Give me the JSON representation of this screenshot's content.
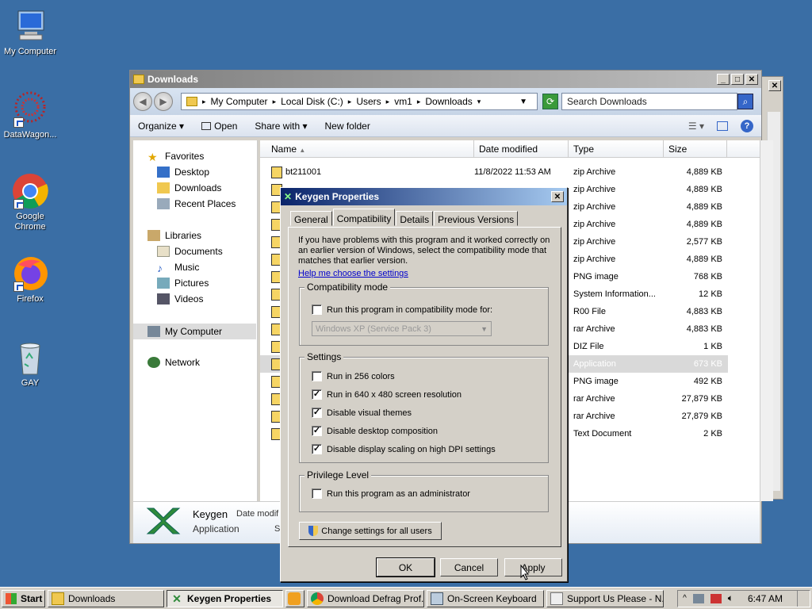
{
  "desktop": {
    "icons": [
      {
        "label": "My Computer",
        "icon": "computer-icon"
      },
      {
        "label": "DataWagon...",
        "icon": "datawagon-icon"
      },
      {
        "label": "Google Chrome",
        "icon": "chrome-icon"
      },
      {
        "label": "Firefox",
        "icon": "firefox-icon"
      },
      {
        "label": "GAY",
        "icon": "recycle-bin-icon"
      }
    ]
  },
  "explorer": {
    "title": "Downloads",
    "breadcrumb": [
      "My Computer",
      "Local Disk (C:)",
      "Users",
      "vm1",
      "Downloads"
    ],
    "search_placeholder": "Search Downloads",
    "commands": {
      "organize": "Organize",
      "open": "Open",
      "share": "Share with",
      "newfolder": "New folder"
    },
    "nav": {
      "favorites": "Favorites",
      "desktop": "Desktop",
      "downloads": "Downloads",
      "recent": "Recent Places",
      "libraries": "Libraries",
      "documents": "Documents",
      "music": "Music",
      "pictures": "Pictures",
      "videos": "Videos",
      "mycomputer": "My Computer",
      "network": "Network"
    },
    "columns": {
      "name": "Name",
      "date": "Date modified",
      "type": "Type",
      "size": "Size"
    },
    "files": [
      {
        "name": "bt211001",
        "date": "11/8/2022 11:53 AM",
        "type": "zip Archive",
        "size": "4,889 KB"
      },
      {
        "name": "",
        "date": "",
        "type": "zip Archive",
        "size": "4,889 KB"
      },
      {
        "name": "",
        "date": "",
        "type": "zip Archive",
        "size": "4,889 KB"
      },
      {
        "name": "",
        "date": "",
        "type": "zip Archive",
        "size": "4,889 KB"
      },
      {
        "name": "",
        "date": "",
        "type": "zip Archive",
        "size": "2,577 KB"
      },
      {
        "name": "",
        "date": "",
        "type": "zip Archive",
        "size": "4,889 KB"
      },
      {
        "name": "",
        "date": "",
        "type": "PNG image",
        "size": "768 KB"
      },
      {
        "name": "",
        "date": "",
        "type": "System Information...",
        "size": "12 KB"
      },
      {
        "name": "",
        "date": "",
        "type": "R00 File",
        "size": "4,883 KB"
      },
      {
        "name": "",
        "date": "",
        "type": "rar Archive",
        "size": "4,883 KB"
      },
      {
        "name": "",
        "date": "",
        "type": "DIZ File",
        "size": "1 KB"
      },
      {
        "name": "",
        "date": "",
        "type": "Application",
        "size": "673 KB"
      },
      {
        "name": "",
        "date": "",
        "type": "PNG image",
        "size": "492 KB"
      },
      {
        "name": "",
        "date": "",
        "type": "rar Archive",
        "size": "27,879 KB"
      },
      {
        "name": "",
        "date": "",
        "type": "rar Archive",
        "size": "27,879 KB"
      },
      {
        "name": "",
        "date": "",
        "type": "Text Document",
        "size": "2 KB"
      }
    ],
    "details": {
      "name": "Keygen",
      "type": "Application",
      "date_label": "Date modif",
      "size_label": "Si"
    }
  },
  "dialog": {
    "title": "Keygen Properties",
    "tabs": [
      "General",
      "Compatibility",
      "Details",
      "Previous Versions"
    ],
    "intro": "If you have problems with this program and it worked correctly on an earlier version of Windows, select the compatibility mode that matches that earlier version.",
    "help_link": "Help me choose the settings",
    "compat_group": "Compatibility mode",
    "compat_check": "Run this program in compatibility mode for:",
    "compat_select": "Windows XP (Service Pack 3)",
    "settings_group": "Settings",
    "settings": [
      {
        "label": "Run in 256 colors",
        "checked": false
      },
      {
        "label": "Run in 640 x 480 screen resolution",
        "checked": true
      },
      {
        "label": "Disable visual themes",
        "checked": true
      },
      {
        "label": "Disable desktop composition",
        "checked": true
      },
      {
        "label": "Disable display scaling on high DPI settings",
        "checked": true
      }
    ],
    "privilege_group": "Privilege Level",
    "admin_check": "Run this program as an administrator",
    "change_all": "Change settings for all users",
    "ok": "OK",
    "cancel": "Cancel",
    "apply": "Apply"
  },
  "taskbar": {
    "start": "Start",
    "items": [
      "Downloads",
      "Keygen Properties",
      "Download Defrag Prof...",
      "On-Screen Keyboard",
      "Support Us Please - N..."
    ],
    "clock": "6:47 AM"
  }
}
